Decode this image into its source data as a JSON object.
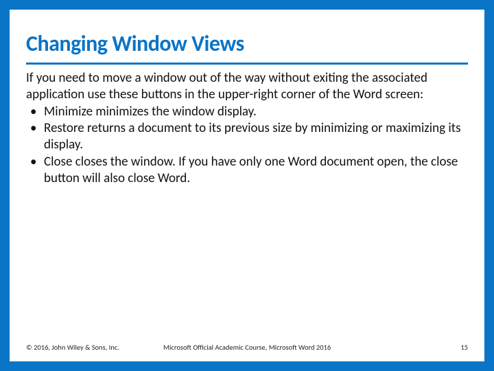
{
  "slide": {
    "title": "Changing Window Views",
    "intro": "If you need to move a window out of the way without exiting the associated application use these buttons in the upper-right corner of the Word screen:",
    "bullets": [
      "Minimize minimizes the window display.",
      "Restore returns a document to its previous size by minimizing or maximizing its display.",
      "Close closes the window. If you have only one Word document open, the close button will also close Word."
    ]
  },
  "footer": {
    "copyright": "© 2016, John Wiley & Sons, Inc.",
    "course": "Microsoft Official Academic Course, Microsoft Word 2016",
    "page": "15"
  },
  "colors": {
    "brand": "#0a74c6"
  }
}
